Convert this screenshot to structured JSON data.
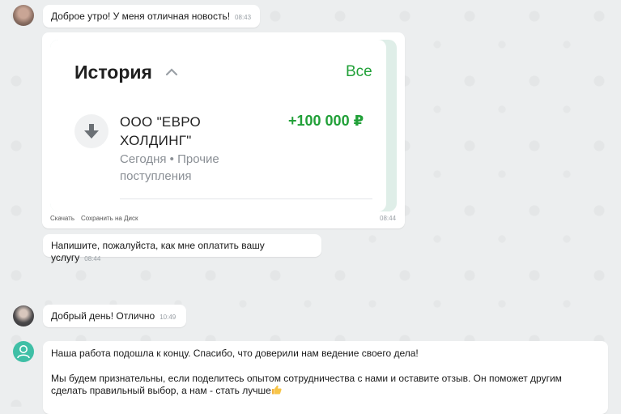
{
  "messages": [
    {
      "text": "Доброе утро! У меня отличная новость!",
      "time": "08:43"
    },
    {
      "time": "08:44",
      "actions": [
        "Скачать",
        "Сохранить на Диск"
      ]
    },
    {
      "text": "Напишите, пожалуйста, как мне оплатить вашу услугу",
      "time": "08:44"
    },
    {
      "text": "Добрый день! Отлично",
      "time": "10:49"
    },
    {
      "paragraph1": "Наша работа подошла к концу. Спасибо, что доверили нам ведение своего дела!",
      "paragraph2": "Мы будем признательны, если поделитесь опытом сотрудничества с нами и оставите отзыв. Он поможет другим сделать правильный выбор, а нам - стать лучше"
    }
  ],
  "card": {
    "title": "История",
    "all_link": "Все",
    "operation_name": "ООО \"ЕВРО ХОЛДИНГ\"",
    "operation_sub": "Сегодня • Прочие поступления",
    "amount": "+100 000 ₽"
  },
  "icons": {
    "avatar_1": "user-photo",
    "avatar_2": "user-photo",
    "avatar_3": "person-icon",
    "card_expand": "chevron-up-icon",
    "operation": "arrow-down-icon",
    "emoji": "thumbs-up-emoji"
  },
  "colors": {
    "accent_green": "#21a038",
    "bubble": "#ffffff",
    "background": "#eceeef"
  }
}
